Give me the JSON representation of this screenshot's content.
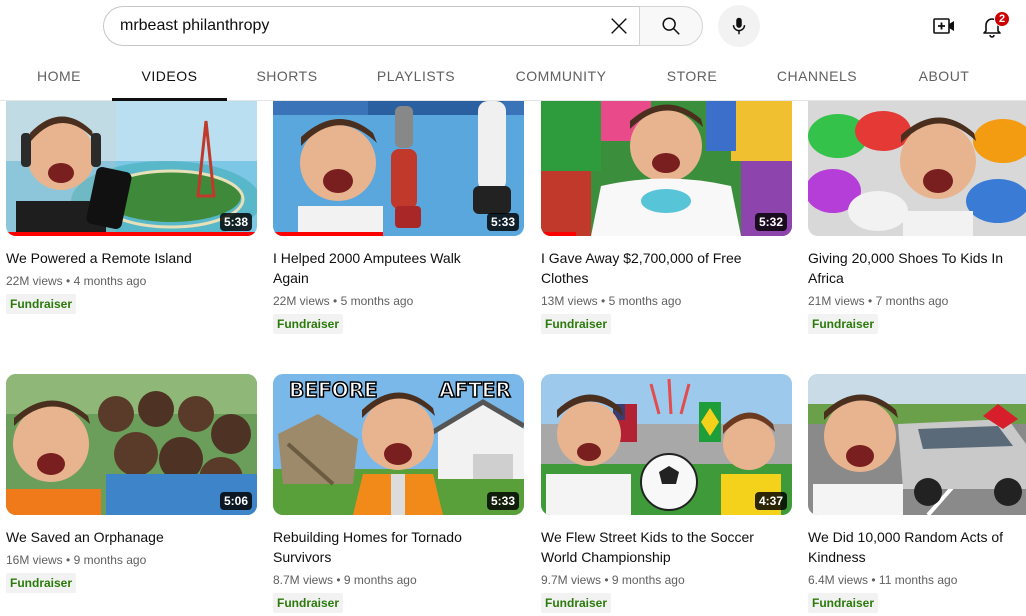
{
  "search": {
    "query": "mrbeast philanthropy"
  },
  "notifications": {
    "count": "2"
  },
  "tabs": [
    {
      "label": "HOME",
      "active": false
    },
    {
      "label": "VIDEOS",
      "active": true
    },
    {
      "label": "SHORTS",
      "active": false
    },
    {
      "label": "PLAYLISTS",
      "active": false
    },
    {
      "label": "COMMUNITY",
      "active": false
    },
    {
      "label": "STORE",
      "active": false
    },
    {
      "label": "CHANNELS",
      "active": false
    },
    {
      "label": "ABOUT",
      "active": false
    }
  ],
  "videos": [
    {
      "title": "We Powered a Remote Island",
      "views": "22M views",
      "age": "4 months ago",
      "duration": "5:38",
      "badge": "Fundraiser",
      "watched": 1.0
    },
    {
      "title": "I Helped 2000 Amputees Walk Again",
      "views": "22M views",
      "age": "5 months ago",
      "duration": "5:33",
      "badge": "Fundraiser",
      "watched": 0.44
    },
    {
      "title": "I Gave Away $2,700,000 of Free Clothes",
      "views": "13M views",
      "age": "5 months ago",
      "duration": "5:32",
      "badge": "Fundraiser",
      "watched": 0.14
    },
    {
      "title": "Giving 20,000 Shoes To Kids In Africa",
      "views": "21M views",
      "age": "7 months ago",
      "duration": "",
      "badge": "Fundraiser",
      "watched": 0
    },
    {
      "title": "We Saved an Orphanage",
      "views": "16M views",
      "age": "9 months ago",
      "duration": "5:06",
      "badge": "Fundraiser",
      "watched": 0
    },
    {
      "title": "Rebuilding Homes for Tornado Survivors",
      "views": "8.7M views",
      "age": "9 months ago",
      "duration": "5:33",
      "badge": "Fundraiser",
      "watched": 0,
      "overlay_left": "BEFORE",
      "overlay_right": "AFTER"
    },
    {
      "title": "We Flew Street Kids to the Soccer World Championship",
      "views": "9.7M views",
      "age": "9 months ago",
      "duration": "4:37",
      "badge": "Fundraiser",
      "watched": 0
    },
    {
      "title": "We Did 10,000 Random Acts of Kindness",
      "views": "6.4M views",
      "age": "11 months ago",
      "duration": "",
      "badge": "Fundraiser",
      "watched": 0
    }
  ],
  "icons": {
    "clear": "close-icon",
    "search": "search-icon",
    "mic": "microphone-icon",
    "create": "create-video-icon",
    "notifications": "bell-icon"
  },
  "colors": {
    "fundraiser": "#2b7a0b",
    "progress": "#ff0000",
    "badge": "#cc0000"
  }
}
